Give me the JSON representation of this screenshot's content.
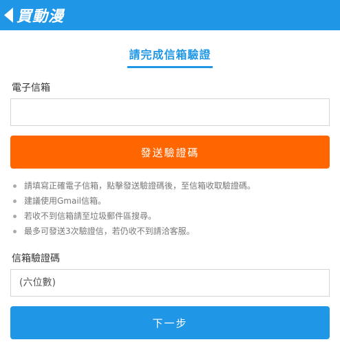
{
  "header": {
    "back_icon": "chevron-left-icon",
    "brand": "買動漫",
    "color": "#1f97e6"
  },
  "page": {
    "title": "請完成信箱驗證"
  },
  "email": {
    "label": "電子信箱",
    "value": "",
    "placeholder": ""
  },
  "send_button": {
    "label": "發送驗證碼",
    "color": "#ff6600"
  },
  "notes": [
    "請填寫正確電子信箱，點擊發送驗證碼後，至信箱收取驗證碼。",
    "建議使用Gmail信箱。",
    "若收不到信箱請至垃圾郵件區搜尋。",
    "最多可發送3次驗證信，若仍收不到請洽客服。"
  ],
  "code": {
    "label": "信箱驗證碼",
    "value": "",
    "placeholder": "(六位數)"
  },
  "next_button": {
    "label": "下一步",
    "color": "#1f97e6"
  }
}
